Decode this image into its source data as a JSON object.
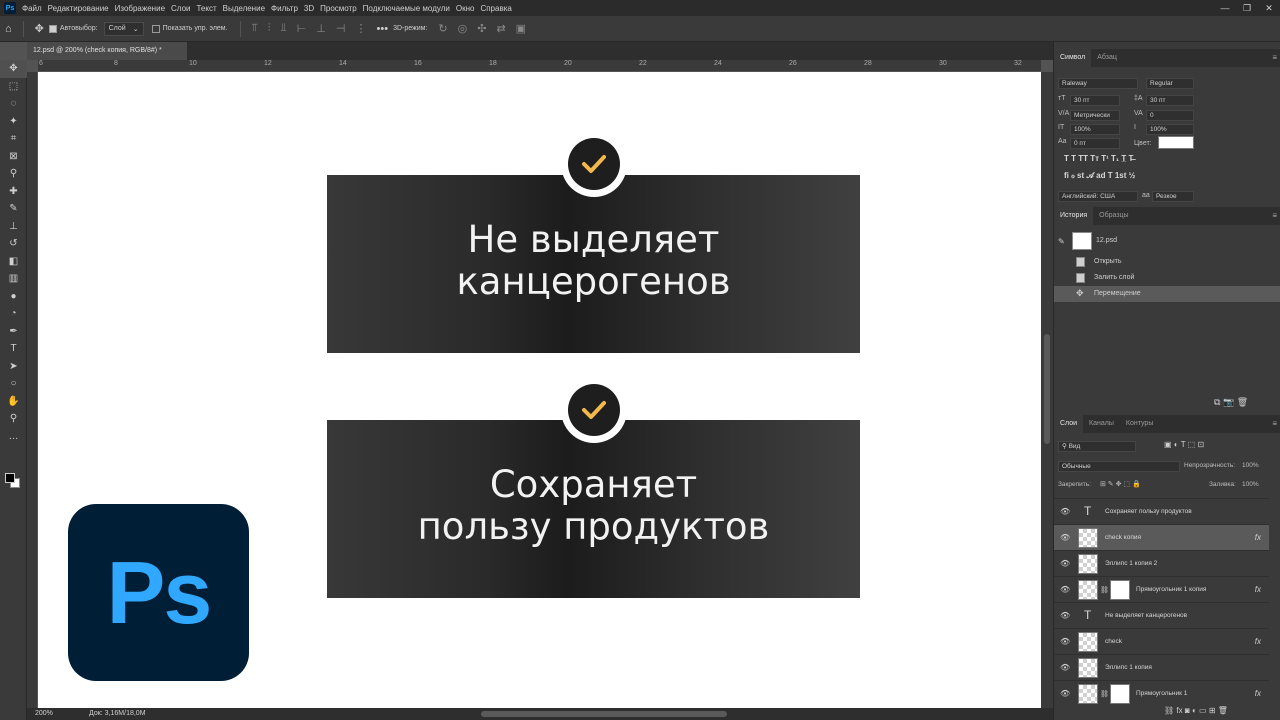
{
  "app": {
    "logo_mini": "Ps"
  },
  "menu": [
    "Файл",
    "Редактирование",
    "Изображение",
    "Слои",
    "Текст",
    "Выделение",
    "Фильтр",
    "3D",
    "Просмотр",
    "Подключаемые модули",
    "Окно",
    "Справка"
  ],
  "window_controls": [
    "—",
    "❐",
    "✕"
  ],
  "options_bar": {
    "autoselect_label": "Автовыбор:",
    "autoselect_value": "Слой",
    "show_transform_label": "Показать упр. элем.",
    "mode_3d_label": "3D-режим:"
  },
  "document": {
    "tab_title": "12.psd @ 200% (check копия, RGB/8#) *"
  },
  "ruler_h": [
    "6",
    "8",
    "10",
    "12",
    "14",
    "16",
    "18",
    "20",
    "22",
    "24",
    "26",
    "28",
    "30",
    "32"
  ],
  "canvas": {
    "card1_line1": "Не выделяет",
    "card1_line2": "канцерогенов",
    "card2_line1": "Сохраняет",
    "card2_line2": "пользу продуктов",
    "check_color": "#f2b84b",
    "card_color": "#2a2a2a"
  },
  "ps_logo": {
    "text": "Ps",
    "bg": "#001e36",
    "fg": "#31a8ff"
  },
  "status": {
    "zoom": "200%",
    "doc": "Док: 3,16M/18,0M"
  },
  "character_panel": {
    "tab_active": "Символ",
    "tab_other": "Абзац",
    "font_family": "Raleway",
    "font_style": "Regular",
    "size": "30 пт",
    "leading": "30 пт",
    "kerning": "Метрически",
    "tracking": "0",
    "vscale": "100%",
    "hscale": "100%",
    "baseline": "0 пт",
    "color_label": "Цвет:",
    "language": "Английский: США",
    "antialias": "Резкое"
  },
  "history_panel": {
    "tab_active": "История",
    "tab_other": "Образцы",
    "snapshot": "12.psd",
    "items": [
      "Открыть",
      "Залить слой",
      "Перемещение"
    ]
  },
  "layers_panel": {
    "tab_active": "Слои",
    "tab_channels": "Каналы",
    "tab_paths": "Контуры",
    "filter_kind": "Вид",
    "blend_mode": "Обычные",
    "opacity_label": "Непрозрачность:",
    "opacity": "100%",
    "lock_label": "Закрепить:",
    "fill_label": "Заливка:",
    "fill": "100%",
    "layers": [
      {
        "name": "Сохраняет пользу продуктов",
        "type": "text",
        "fx": ""
      },
      {
        "name": "check копия",
        "type": "smart",
        "fx": "fx"
      },
      {
        "name": "Эллипс 1 копия 2",
        "type": "shape",
        "fx": ""
      },
      {
        "name": "Прямоугольник 1 копия",
        "type": "masked",
        "fx": "fx"
      },
      {
        "name": "Не выделяет канцерогенов",
        "type": "text",
        "fx": ""
      },
      {
        "name": "check",
        "type": "smart",
        "fx": "fx"
      },
      {
        "name": "Эллипс 1 копия",
        "type": "shape",
        "fx": ""
      },
      {
        "name": "Прямоугольник 1",
        "type": "masked",
        "fx": "fx"
      }
    ]
  }
}
